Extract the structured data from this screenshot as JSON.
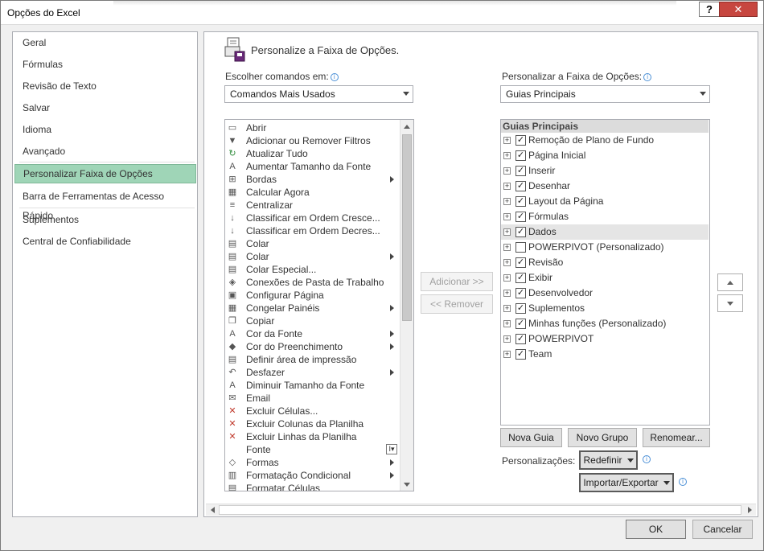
{
  "window": {
    "title": "Opções do Excel",
    "help_label": "?",
    "close_label": "✕"
  },
  "nav": {
    "items": [
      {
        "label": "Geral"
      },
      {
        "label": "Fórmulas"
      },
      {
        "label": "Revisão de Texto"
      },
      {
        "label": "Salvar"
      },
      {
        "label": "Idioma"
      },
      {
        "label": "Avançado"
      },
      {
        "label": "Personalizar Faixa de Opções",
        "selected": true
      },
      {
        "label": "Barra de Ferramentas de Acesso Rápido"
      },
      {
        "label": "Suplementos"
      },
      {
        "label": "Central de Confiabilidade"
      }
    ]
  },
  "header": {
    "title": "Personalize a Faixa de Opções."
  },
  "left": {
    "label": "Escolher comandos em:",
    "dropdown_value": "Comandos Mais Usados",
    "commands": [
      {
        "label": "Abrir",
        "icon": "folder-icon"
      },
      {
        "label": "Adicionar ou Remover Filtros",
        "icon": "filter-icon"
      },
      {
        "label": "Atualizar Tudo",
        "icon": "refresh-icon"
      },
      {
        "label": "Aumentar Tamanho da Fonte",
        "icon": "font-grow-icon"
      },
      {
        "label": "Bordas",
        "icon": "borders-icon",
        "submenu": true
      },
      {
        "label": "Calcular Agora",
        "icon": "calculator-icon"
      },
      {
        "label": "Centralizar",
        "icon": "align-center-icon"
      },
      {
        "label": "Classificar em Ordem Cresce...",
        "icon": "sort-asc-icon"
      },
      {
        "label": "Classificar em Ordem Decres...",
        "icon": "sort-desc-icon"
      },
      {
        "label": "Colar",
        "icon": "paste-icon"
      },
      {
        "label": "Colar",
        "icon": "paste-icon",
        "submenu": true
      },
      {
        "label": "Colar Especial...",
        "icon": "paste-special-icon"
      },
      {
        "label": "Conexões de Pasta de Trabalho",
        "icon": "connections-icon"
      },
      {
        "label": "Configurar Página",
        "icon": "page-setup-icon"
      },
      {
        "label": "Congelar Painéis",
        "icon": "freeze-panes-icon",
        "submenu": true
      },
      {
        "label": "Copiar",
        "icon": "copy-icon"
      },
      {
        "label": "Cor da Fonte",
        "icon": "font-color-icon",
        "submenu": true
      },
      {
        "label": "Cor do Preenchimento",
        "icon": "fill-color-icon",
        "submenu": true
      },
      {
        "label": "Definir área de impressão",
        "icon": "print-area-icon"
      },
      {
        "label": "Desfazer",
        "icon": "undo-icon",
        "submenu": true
      },
      {
        "label": "Diminuir Tamanho da Fonte",
        "icon": "font-shrink-icon"
      },
      {
        "label": "Email",
        "icon": "email-icon"
      },
      {
        "label": "Excluir Células...",
        "icon": "delete-cells-icon"
      },
      {
        "label": "Excluir Colunas da Planilha",
        "icon": "delete-columns-icon"
      },
      {
        "label": "Excluir Linhas da Planilha",
        "icon": "delete-rows-icon"
      },
      {
        "label": "Fonte",
        "icon": "",
        "font_picker": true
      },
      {
        "label": "Formas",
        "icon": "shapes-icon",
        "submenu": true
      },
      {
        "label": "Formatação Condicional",
        "icon": "conditional-format-icon",
        "submenu": true
      },
      {
        "label": "Formatar Células",
        "icon": "format-cells-icon"
      }
    ]
  },
  "middle": {
    "add_label": "Adicionar >>",
    "remove_label": "<< Remover"
  },
  "right": {
    "label": "Personalizar a Faixa de Opções:",
    "dropdown_value": "Guias Principais",
    "tree_header": "Guias Principais",
    "tabs": [
      {
        "label": "Remoção de Plano de Fundo",
        "checked": true
      },
      {
        "label": "Página Inicial",
        "checked": true
      },
      {
        "label": "Inserir",
        "checked": true
      },
      {
        "label": "Desenhar",
        "checked": true
      },
      {
        "label": "Layout da Página",
        "checked": true
      },
      {
        "label": "Fórmulas",
        "checked": true
      },
      {
        "label": "Dados",
        "checked": true,
        "highlighted": true
      },
      {
        "label": "POWERPIVOT (Personalizado)",
        "checked": false
      },
      {
        "label": "Revisão",
        "checked": true
      },
      {
        "label": "Exibir",
        "checked": true
      },
      {
        "label": "Desenvolvedor",
        "checked": true
      },
      {
        "label": "Suplementos",
        "checked": true
      },
      {
        "label": "Minhas funções (Personalizado)",
        "checked": true
      },
      {
        "label": "POWERPIVOT",
        "checked": true
      },
      {
        "label": "Team",
        "checked": true
      }
    ],
    "new_tab_label": "Nova Guia",
    "new_group_label": "Novo Grupo",
    "rename_label": "Renomear...",
    "customizations_label": "Personalizações:",
    "reset_label": "Redefinir",
    "import_export_label": "Importar/Exportar"
  },
  "footer": {
    "ok_label": "OK",
    "cancel_label": "Cancelar"
  },
  "colors": {
    "nav_selected": "#9fd5b7",
    "close_button": "#c7463f"
  }
}
